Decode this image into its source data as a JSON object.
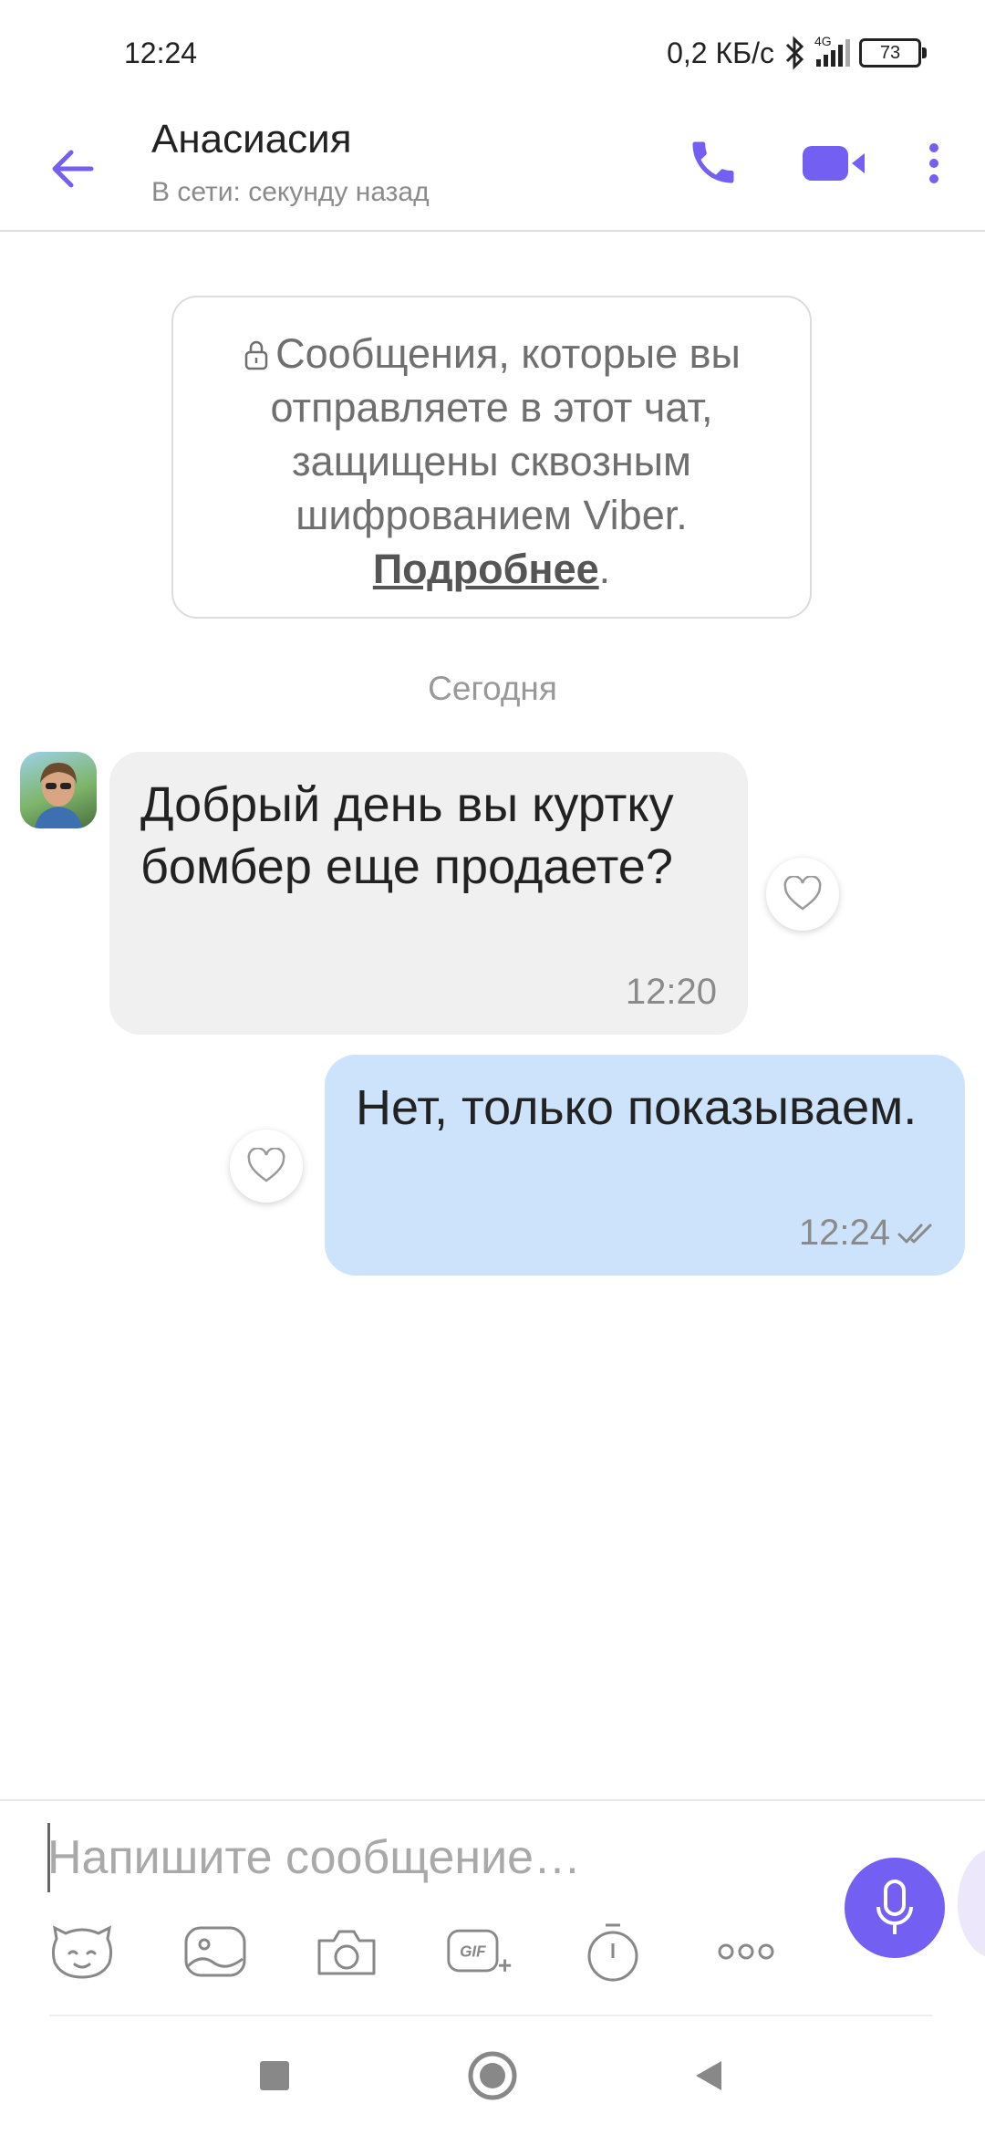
{
  "status_bar": {
    "time": "12:24",
    "speed": "0,2 КБ/с",
    "network": "4G",
    "battery": "73"
  },
  "header": {
    "contact_name": "Анасиасия",
    "presence": "В сети: секунду назад",
    "accent_color": "#7360f2"
  },
  "notice": {
    "text": "Сообщения, которые вы отправляете в этот чат, защищены сквозным шифрованием Viber.",
    "link": "Подробнее",
    "after_link": "."
  },
  "date_separator": "Сегодня",
  "messages": [
    {
      "direction": "incoming",
      "text": "Добрый день вы куртку бомбер еще продаете?",
      "time": "12:20"
    },
    {
      "direction": "outgoing",
      "text": "Нет, только показываем.",
      "time": "12:24",
      "status": "read"
    }
  ],
  "composer": {
    "placeholder": "Напишите сообщение…",
    "tools": [
      "sticker-icon",
      "gallery-icon",
      "camera-icon",
      "gif-icon",
      "timer-icon",
      "more-icon"
    ]
  }
}
